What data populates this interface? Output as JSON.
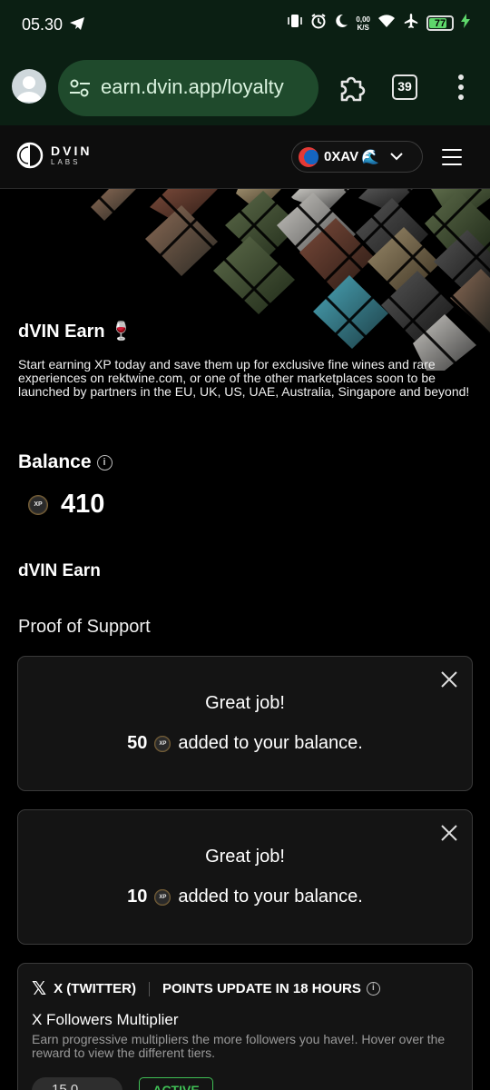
{
  "status_bar": {
    "time": "05.30",
    "net_speed_value": "0,00",
    "net_speed_unit": "K/S",
    "battery": "77"
  },
  "browser": {
    "url": "earn.dvin.app/loyalty",
    "tab_count": "39"
  },
  "header": {
    "logo_main": "DVIN",
    "logo_sub": "LABS",
    "wallet_name": "0XAV",
    "wallet_emoji": "🌊"
  },
  "intro": {
    "title": "dVIN Earn 🍷",
    "description": "Start earning XP today and save them up for exclusive fine wines and rare experiences on rektwine.com, or one of the other marketplaces soon to be launched by partners in the EU, UK, US, UAE, Australia, Singapore and beyond!"
  },
  "balance": {
    "title": "Balance",
    "xp_label": "XP",
    "value": "410"
  },
  "earn_section": {
    "title": "dVIN Earn",
    "subtitle": "Proof of Support"
  },
  "notifications": [
    {
      "heading": "Great job!",
      "amount": "50",
      "suffix": "added to your balance."
    },
    {
      "heading": "Great job!",
      "amount": "10",
      "suffix": "added to your balance."
    }
  ],
  "task": {
    "platform": "X (TWITTER)",
    "update_notice": "POINTS UPDATE IN 18 HOURS",
    "name": "X Followers Multiplier",
    "description": "Earn progressive multipliers the more followers you have!. Hover over the reward to view the different tiers.",
    "reward": "15.0",
    "status": "ACTIVE"
  },
  "colors": {
    "browser_bg": "#0b1f13",
    "url_bg": "#1f4a2c",
    "page_bg": "#000000",
    "card_bg": "#141414",
    "active_green": "#3fbf55"
  }
}
